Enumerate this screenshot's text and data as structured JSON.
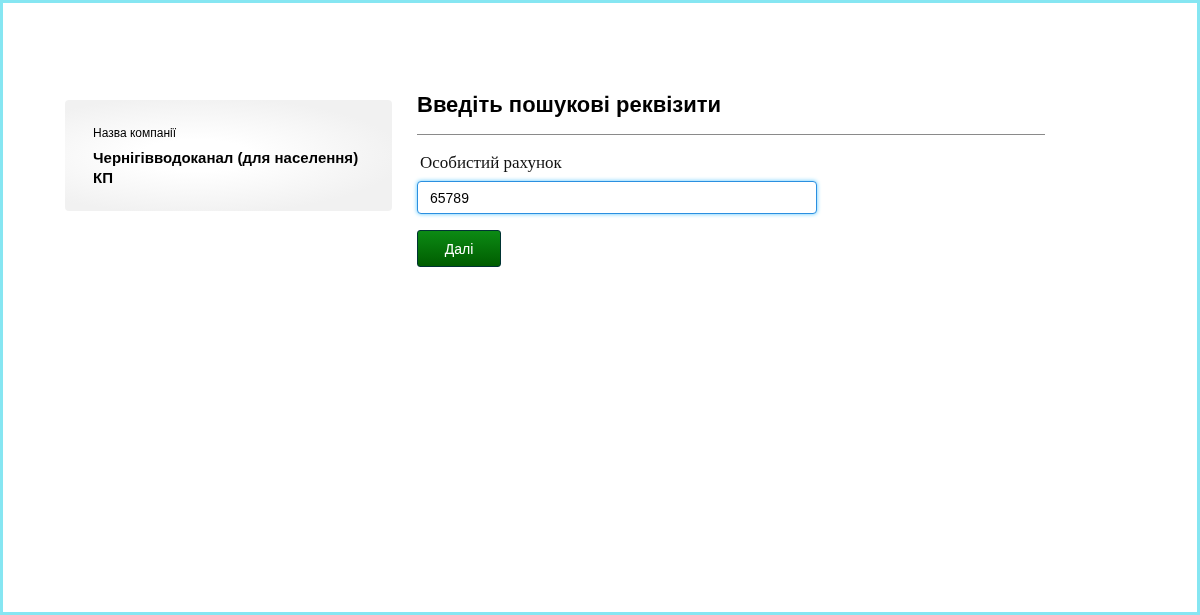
{
  "company_card": {
    "label": "Назва компанії",
    "name": "Чернігівводоканал (для населення) КП"
  },
  "form": {
    "title": "Введіть пошукові реквізити",
    "field_label": "Особистий рахунок",
    "field_value": "65789",
    "button": "Далі"
  }
}
